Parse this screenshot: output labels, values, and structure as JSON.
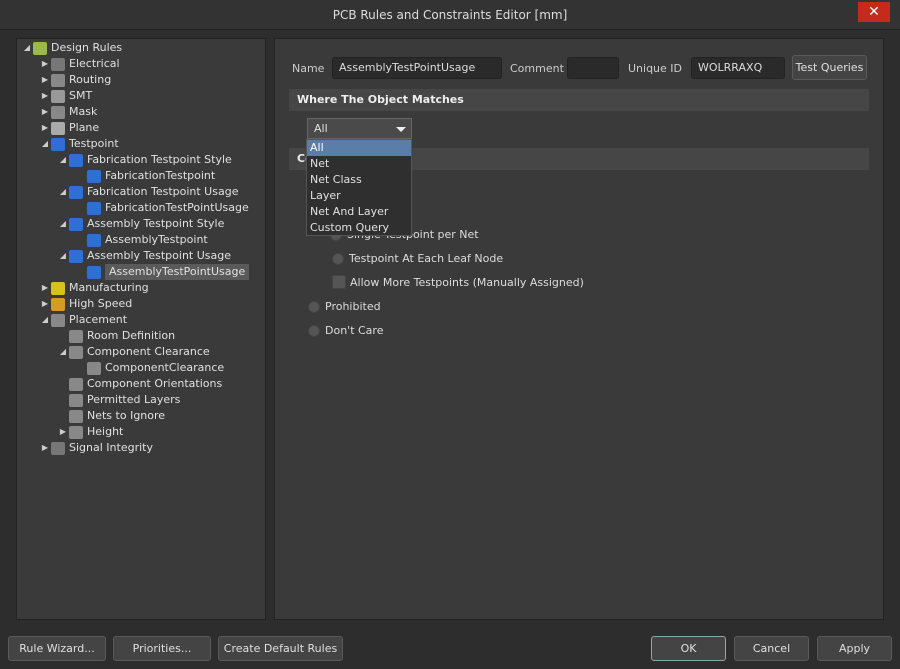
{
  "window": {
    "title": "PCB Rules and Constraints Editor [mm]",
    "close": "✕"
  },
  "tree": [
    {
      "label": "Design Rules",
      "level": 0,
      "arrow": "◢",
      "icon": "folder-icon",
      "color": "#9bb84a"
    },
    {
      "label": "Electrical",
      "level": 1,
      "arrow": "▶",
      "icon": "electrical-icon",
      "color": "#777"
    },
    {
      "label": "Routing",
      "level": 1,
      "arrow": "▶",
      "icon": "routing-icon",
      "color": "#888"
    },
    {
      "label": "SMT",
      "level": 1,
      "arrow": "▶",
      "icon": "smt-icon",
      "color": "#999"
    },
    {
      "label": "Mask",
      "level": 1,
      "arrow": "▶",
      "icon": "mask-icon",
      "color": "#888"
    },
    {
      "label": "Plane",
      "level": 1,
      "arrow": "▶",
      "icon": "plane-icon",
      "color": "#aaa"
    },
    {
      "label": "Testpoint",
      "level": 1,
      "arrow": "◢",
      "icon": "testpoint-icon",
      "color": "#2d6fd6"
    },
    {
      "label": "Fabrication Testpoint Style",
      "level": 2,
      "arrow": "◢",
      "icon": "testpoint-icon",
      "color": "#2d6fd6"
    },
    {
      "label": "FabricationTestpoint",
      "level": 3,
      "arrow": "",
      "icon": "testpoint-icon",
      "color": "#2d6fd6"
    },
    {
      "label": "Fabrication Testpoint Usage",
      "level": 2,
      "arrow": "◢",
      "icon": "testpoint-icon",
      "color": "#2d6fd6"
    },
    {
      "label": "FabricationTestPointUsage",
      "level": 3,
      "arrow": "",
      "icon": "testpoint-icon",
      "color": "#2d6fd6"
    },
    {
      "label": "Assembly Testpoint Style",
      "level": 2,
      "arrow": "◢",
      "icon": "testpoint-icon",
      "color": "#2d6fd6"
    },
    {
      "label": "AssemblyTestpoint",
      "level": 3,
      "arrow": "",
      "icon": "testpoint-icon",
      "color": "#2d6fd6"
    },
    {
      "label": "Assembly Testpoint Usage",
      "level": 2,
      "arrow": "◢",
      "icon": "testpoint-icon",
      "color": "#2d6fd6"
    },
    {
      "label": "AssemblyTestPointUsage",
      "level": 3,
      "arrow": "",
      "icon": "testpoint-icon",
      "color": "#2d6fd6",
      "selected": true
    },
    {
      "label": "Manufacturing",
      "level": 1,
      "arrow": "▶",
      "icon": "manufacturing-icon",
      "color": "#d8c020"
    },
    {
      "label": "High Speed",
      "level": 1,
      "arrow": "▶",
      "icon": "high-speed-icon",
      "color": "#d89a20"
    },
    {
      "label": "Placement",
      "level": 1,
      "arrow": "◢",
      "icon": "placement-icon",
      "color": "#888"
    },
    {
      "label": "Room Definition",
      "level": 2,
      "arrow": "",
      "icon": "placement-icon",
      "color": "#888"
    },
    {
      "label": "Component Clearance",
      "level": 2,
      "arrow": "◢",
      "icon": "placement-icon",
      "color": "#888"
    },
    {
      "label": "ComponentClearance",
      "level": 3,
      "arrow": "",
      "icon": "placement-icon",
      "color": "#888"
    },
    {
      "label": "Component Orientations",
      "level": 2,
      "arrow": "",
      "icon": "placement-icon",
      "color": "#888"
    },
    {
      "label": "Permitted Layers",
      "level": 2,
      "arrow": "",
      "icon": "placement-icon",
      "color": "#888"
    },
    {
      "label": "Nets to Ignore",
      "level": 2,
      "arrow": "",
      "icon": "placement-icon",
      "color": "#888"
    },
    {
      "label": "Height",
      "level": 2,
      "arrow": "▶",
      "icon": "placement-icon",
      "color": "#888"
    },
    {
      "label": "Signal Integrity",
      "level": 1,
      "arrow": "▶",
      "icon": "signal-integrity-icon",
      "color": "#777"
    }
  ],
  "header": {
    "name_label": "Name",
    "name_value": "AssemblyTestPointUsage",
    "comment_label": "Comment",
    "comment_value": "",
    "uid_label": "Unique ID",
    "uid_value": "WOLRRAXQ",
    "test_queries": "Test Queries"
  },
  "where": {
    "title": "Where The Object Matches",
    "selected": "All",
    "options": [
      "All",
      "Net",
      "Net Class",
      "Layer",
      "Net And Layer",
      "Custom Query"
    ]
  },
  "constraints": {
    "title": "Constraints",
    "single": "Single Testpoint per Net",
    "leaf": "Testpoint At Each Leaf Node",
    "allow_more": "Allow More Testpoints (Manually Assigned)",
    "prohibited": "Prohibited",
    "dont_care": "Don't Care"
  },
  "footer": {
    "rule_wizard": "Rule Wizard...",
    "priorities": "Priorities...",
    "create_default": "Create Default Rules",
    "ok": "OK",
    "cancel": "Cancel",
    "apply": "Apply"
  }
}
